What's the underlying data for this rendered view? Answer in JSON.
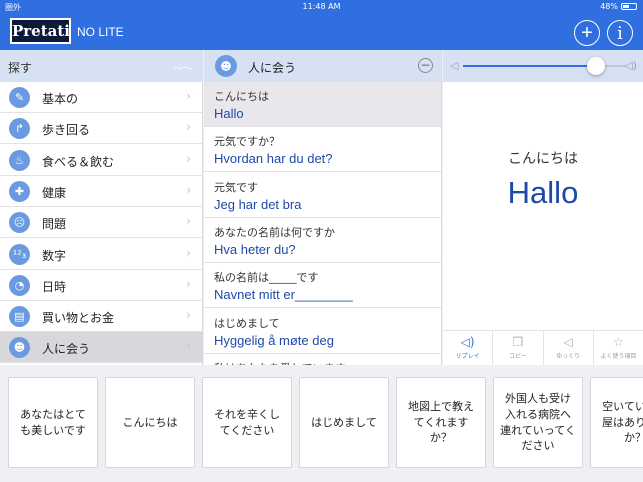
{
  "status": {
    "carrier": "圏外",
    "time": "11:48 AM",
    "battery": "48%",
    "battery_level": 0.48
  },
  "header": {
    "logo": "Pretati",
    "edition": "NO LITE",
    "add_symbol": "+",
    "info_symbol": "i"
  },
  "search": {
    "label": "探す",
    "hint": "〜〜"
  },
  "categories": [
    {
      "label": "基本の",
      "icon": "✎"
    },
    {
      "label": "歩き回る",
      "icon": "↱"
    },
    {
      "label": "食べる＆飲む",
      "icon": "♨"
    },
    {
      "label": "健康",
      "icon": "✚"
    },
    {
      "label": "問題",
      "icon": "☹"
    },
    {
      "label": "数字",
      "icon": "¹²₃"
    },
    {
      "label": "日時",
      "icon": "◔"
    },
    {
      "label": "買い物とお金",
      "icon": "▤"
    },
    {
      "label": "人に会う",
      "icon": "☻"
    }
  ],
  "list": {
    "title": "人に会う",
    "icon": "☻",
    "minus": "−",
    "phrases": [
      {
        "jp": "こんにちは",
        "no": "Hallo"
      },
      {
        "jp": "元気ですか？",
        "no": "Hvordan har du det?"
      },
      {
        "jp": "元気です",
        "no": "Jeg har det bra"
      },
      {
        "jp": "あなたの名前は何ですか",
        "no": "Hva heter du?"
      },
      {
        "jp": "私の名前は_____です",
        "no": "Navnet mitt er________"
      },
      {
        "jp": "はじめまして",
        "no": "Hyggelig å møte deg"
      },
      {
        "jp": "私はあなたを愛しています",
        "no": ""
      }
    ]
  },
  "display": {
    "jp": "こんにちは",
    "no": "Hallo",
    "volume_level": 0.82,
    "vol_low_icon": "◁",
    "vol_high_icon": "◁)",
    "tools": [
      {
        "label": "リプレイ",
        "icon": "◁)"
      },
      {
        "label": "コピー",
        "icon": "❐"
      },
      {
        "label": "ゆっくり",
        "icon": "◁"
      },
      {
        "label": "よく使う項目",
        "icon": "☆"
      }
    ]
  },
  "recent": [
    "あなたはとても美しいです",
    "こんにちは",
    "それを辛くしてください",
    "はじめまして",
    "地図上で教えてくれますか？",
    "外国人も受け入れる病院へ連れていってください",
    "空いている部屋はありますか？"
  ],
  "colors": {
    "header": "#2f6fe0",
    "accent_text": "#1f49a8",
    "section_bar": "#d6e1f3"
  }
}
